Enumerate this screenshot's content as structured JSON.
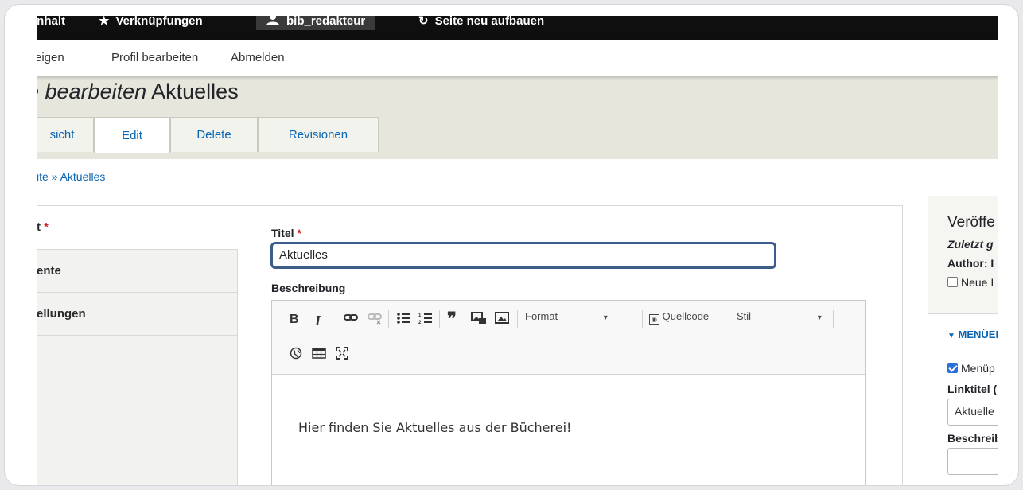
{
  "toolbar": {
    "items": [
      {
        "label": "Inhalt",
        "icon": "menu-icon"
      },
      {
        "label": "Verknüpfungen",
        "icon": "star-icon"
      },
      {
        "label": "bib_redakteur",
        "icon": "user-icon"
      },
      {
        "label": "Seite neu aufbauen",
        "icon": "refresh-icon"
      }
    ]
  },
  "userbar": {
    "items": [
      "eigen",
      "Profil bearbeiten",
      "Abmelden"
    ]
  },
  "header": {
    "title_prefix": "e bearbeiten",
    "title_main": "Aktuelles",
    "tabs": [
      {
        "label": "sicht",
        "active": false
      },
      {
        "label": "Edit",
        "active": true
      },
      {
        "label": "Delete",
        "active": false
      },
      {
        "label": "Revisionen",
        "active": false
      }
    ]
  },
  "breadcrumb": "ite » Aktuelles",
  "vertical_tabs": [
    {
      "label": "t",
      "required": true
    },
    {
      "label": "ente",
      "required": false
    },
    {
      "label": "ellungen",
      "required": false
    }
  ],
  "form": {
    "title_label": "Titel",
    "title_required_mark": "*",
    "title_value": "Aktuelles",
    "description_label": "Beschreibung",
    "editor": {
      "format_label": "Format",
      "source_label": "Quellcode",
      "style_label": "Stil",
      "body_text": "Hier finden Sie Aktuelles aus der Bücherei!"
    }
  },
  "sidebar": {
    "heading": "Veröffe",
    "last_saved": "Zuletzt g",
    "author_label": "Author: I",
    "new_revision": "Neue I",
    "menu_section": "MENÜEI",
    "menu_checkbox": "Menüp",
    "link_title_label": "Linktitel (",
    "link_title_value": "Aktuelle",
    "description_label": "Beschreib"
  },
  "colors": {
    "toolbar_bg": "#0f0f0f",
    "link": "#0a65b3",
    "header_bg": "#e6e6dd",
    "required": "#d0231f",
    "focus_border": "#3c5c8a"
  }
}
